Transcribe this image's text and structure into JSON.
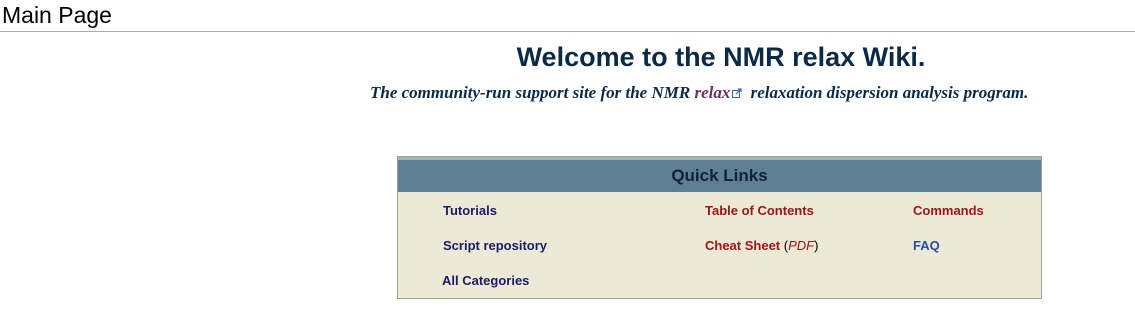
{
  "page": {
    "heading": "Main Page"
  },
  "welcome": {
    "title": "Welcome to the NMR relax Wiki.",
    "tagline_before": "The community-run support site for the NMR",
    "tagline_link": "relax",
    "tagline_after": "relaxation dispersion analysis program."
  },
  "quick_links": {
    "title": "Quick Links",
    "tutorials": "Tutorials",
    "table_of_contents": "Table of Contents",
    "commands": "Commands",
    "script_repository": "Script repository",
    "cheat_sheet": "Cheat Sheet",
    "cheat_sheet_open": "(",
    "cheat_sheet_pdf": "PDF",
    "cheat_sheet_close": ")",
    "faq": "FAQ",
    "all_categories": "All Categories"
  },
  "icons": {
    "external_link": "external-link-icon"
  },
  "colors": {
    "title": "#0a2a45",
    "quick_header_bg": "#5f7f94",
    "quick_body_bg": "#ece9d6",
    "link_navy": "#1c1a6a",
    "link_red": "#a01515",
    "link_blue": "#2a4f9c",
    "link_purple": "#6b2f66"
  }
}
